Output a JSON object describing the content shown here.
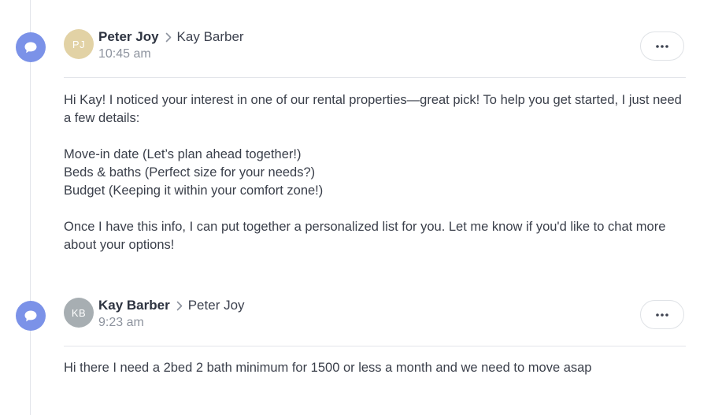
{
  "messages": [
    {
      "channel_icon": "chat-bubble-icon",
      "avatar_initials": "PJ",
      "avatar_color": "#e2d2a5",
      "sender": "Peter Joy",
      "recipient": "Kay Barber",
      "time": "10:45 am",
      "more_icon": "ellipsis-icon",
      "body": {
        "intro": "Hi Kay! I noticed your interest in one of our rental properties—great pick! To help you get started, I just need a few details:",
        "items": [
          "Move-in date (Let’s plan ahead together!)",
          "Beds & baths (Perfect size for your needs?)",
          "Budget (Keeping it within your comfort zone!)"
        ],
        "closing": "Once I have this info, I can put together a personalized list for you. Let me know if you'd like to chat more about your options!"
      }
    },
    {
      "channel_icon": "chat-bubble-icon",
      "avatar_initials": "KB",
      "avatar_color": "#a7aeb2",
      "sender": "Kay Barber",
      "recipient": "Peter Joy",
      "time": "9:23 am",
      "more_icon": "ellipsis-icon",
      "body": {
        "text": "Hi there I need a 2bed 2 bath minimum for 1500 or less a month and we need to move asap"
      }
    }
  ],
  "colors": {
    "channel_icon_bg": "#7b92e8",
    "divider": "#e3e5ea",
    "text": "#3a3f4a",
    "muted": "#8d939e"
  }
}
